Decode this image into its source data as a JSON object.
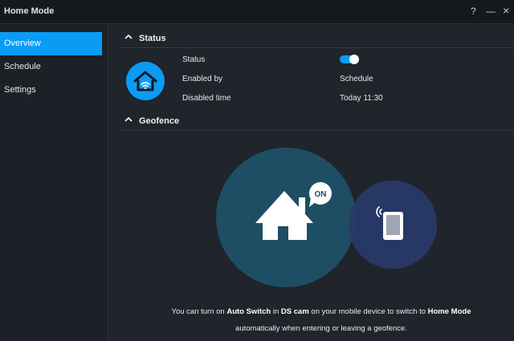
{
  "window": {
    "title": "Home Mode",
    "help_glyph": "?",
    "minimize_glyph": "—",
    "close_glyph": "×"
  },
  "sidebar": {
    "items": [
      {
        "label": "Overview",
        "active": true
      },
      {
        "label": "Schedule",
        "active": false
      },
      {
        "label": "Settings",
        "active": false
      }
    ]
  },
  "status_section": {
    "title": "Status",
    "icon": "home-wifi-icon",
    "rows": [
      {
        "label": "Status",
        "value": "on"
      },
      {
        "label": "Enabled by",
        "value": "Schedule"
      },
      {
        "label": "Disabled time",
        "value": "Today 11:30"
      }
    ]
  },
  "geofence_section": {
    "title": "Geofence",
    "on_badge": "ON",
    "caption": {
      "p1": "You can turn on ",
      "b1": "Auto Switch",
      "p2": " in ",
      "b2": "DS cam",
      "p3": " on your mobile device to switch to ",
      "b3": "Home Mode",
      "p4": " automatically when entering or leaving a geofence."
    }
  },
  "colors": {
    "accent": "#0a9cf4",
    "background": "#20242b",
    "sidebar": "#1d2026",
    "home_circle": "#1d4e63",
    "device_circle": "#293a68"
  }
}
